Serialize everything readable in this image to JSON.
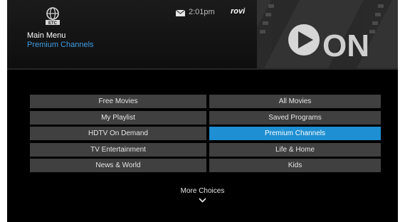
{
  "header": {
    "logo_text": "ETC",
    "menu_title": "Main Menu",
    "menu_subtitle": "Premium Channels",
    "time": "2:01pm",
    "brand": "rovi",
    "banner_text": "ON"
  },
  "menu": {
    "left": [
      "Free Movies",
      "My Playlist",
      "HDTV On Demand",
      "TV Entertainment",
      "News & World"
    ],
    "right": [
      "All Movies",
      "Saved Programs",
      "Premium Channels",
      "Life & Home",
      "Kids"
    ],
    "selected": "Premium Channels"
  },
  "footer": {
    "more_label": "More Choices"
  },
  "colors": {
    "accent": "#1e8fd2",
    "subtitle": "#3f9de6",
    "button": "#404040"
  }
}
